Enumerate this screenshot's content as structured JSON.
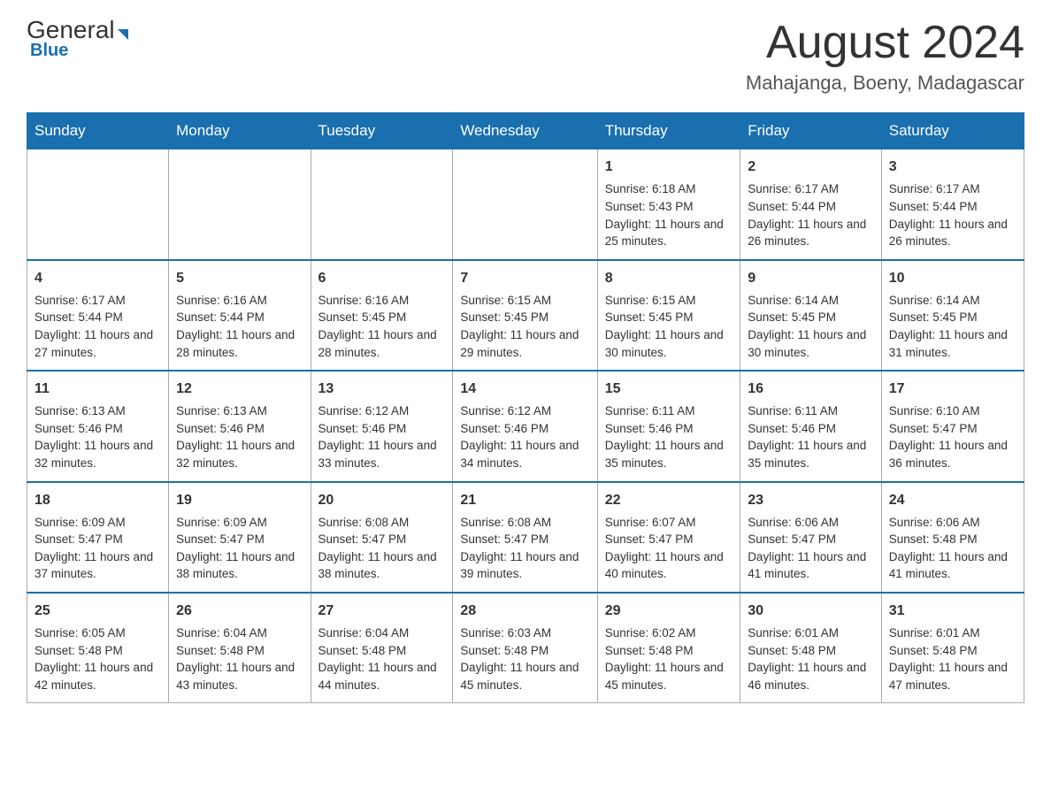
{
  "header": {
    "logo_general": "General",
    "logo_blue": "Blue",
    "month_title": "August 2024",
    "location": "Mahajanga, Boeny, Madagascar"
  },
  "calendar": {
    "days_of_week": [
      "Sunday",
      "Monday",
      "Tuesday",
      "Wednesday",
      "Thursday",
      "Friday",
      "Saturday"
    ],
    "weeks": [
      [
        {
          "day": "",
          "info": ""
        },
        {
          "day": "",
          "info": ""
        },
        {
          "day": "",
          "info": ""
        },
        {
          "day": "",
          "info": ""
        },
        {
          "day": "1",
          "info": "Sunrise: 6:18 AM\nSunset: 5:43 PM\nDaylight: 11 hours and 25 minutes."
        },
        {
          "day": "2",
          "info": "Sunrise: 6:17 AM\nSunset: 5:44 PM\nDaylight: 11 hours and 26 minutes."
        },
        {
          "day": "3",
          "info": "Sunrise: 6:17 AM\nSunset: 5:44 PM\nDaylight: 11 hours and 26 minutes."
        }
      ],
      [
        {
          "day": "4",
          "info": "Sunrise: 6:17 AM\nSunset: 5:44 PM\nDaylight: 11 hours and 27 minutes."
        },
        {
          "day": "5",
          "info": "Sunrise: 6:16 AM\nSunset: 5:44 PM\nDaylight: 11 hours and 28 minutes."
        },
        {
          "day": "6",
          "info": "Sunrise: 6:16 AM\nSunset: 5:45 PM\nDaylight: 11 hours and 28 minutes."
        },
        {
          "day": "7",
          "info": "Sunrise: 6:15 AM\nSunset: 5:45 PM\nDaylight: 11 hours and 29 minutes."
        },
        {
          "day": "8",
          "info": "Sunrise: 6:15 AM\nSunset: 5:45 PM\nDaylight: 11 hours and 30 minutes."
        },
        {
          "day": "9",
          "info": "Sunrise: 6:14 AM\nSunset: 5:45 PM\nDaylight: 11 hours and 30 minutes."
        },
        {
          "day": "10",
          "info": "Sunrise: 6:14 AM\nSunset: 5:45 PM\nDaylight: 11 hours and 31 minutes."
        }
      ],
      [
        {
          "day": "11",
          "info": "Sunrise: 6:13 AM\nSunset: 5:46 PM\nDaylight: 11 hours and 32 minutes."
        },
        {
          "day": "12",
          "info": "Sunrise: 6:13 AM\nSunset: 5:46 PM\nDaylight: 11 hours and 32 minutes."
        },
        {
          "day": "13",
          "info": "Sunrise: 6:12 AM\nSunset: 5:46 PM\nDaylight: 11 hours and 33 minutes."
        },
        {
          "day": "14",
          "info": "Sunrise: 6:12 AM\nSunset: 5:46 PM\nDaylight: 11 hours and 34 minutes."
        },
        {
          "day": "15",
          "info": "Sunrise: 6:11 AM\nSunset: 5:46 PM\nDaylight: 11 hours and 35 minutes."
        },
        {
          "day": "16",
          "info": "Sunrise: 6:11 AM\nSunset: 5:46 PM\nDaylight: 11 hours and 35 minutes."
        },
        {
          "day": "17",
          "info": "Sunrise: 6:10 AM\nSunset: 5:47 PM\nDaylight: 11 hours and 36 minutes."
        }
      ],
      [
        {
          "day": "18",
          "info": "Sunrise: 6:09 AM\nSunset: 5:47 PM\nDaylight: 11 hours and 37 minutes."
        },
        {
          "day": "19",
          "info": "Sunrise: 6:09 AM\nSunset: 5:47 PM\nDaylight: 11 hours and 38 minutes."
        },
        {
          "day": "20",
          "info": "Sunrise: 6:08 AM\nSunset: 5:47 PM\nDaylight: 11 hours and 38 minutes."
        },
        {
          "day": "21",
          "info": "Sunrise: 6:08 AM\nSunset: 5:47 PM\nDaylight: 11 hours and 39 minutes."
        },
        {
          "day": "22",
          "info": "Sunrise: 6:07 AM\nSunset: 5:47 PM\nDaylight: 11 hours and 40 minutes."
        },
        {
          "day": "23",
          "info": "Sunrise: 6:06 AM\nSunset: 5:47 PM\nDaylight: 11 hours and 41 minutes."
        },
        {
          "day": "24",
          "info": "Sunrise: 6:06 AM\nSunset: 5:48 PM\nDaylight: 11 hours and 41 minutes."
        }
      ],
      [
        {
          "day": "25",
          "info": "Sunrise: 6:05 AM\nSunset: 5:48 PM\nDaylight: 11 hours and 42 minutes."
        },
        {
          "day": "26",
          "info": "Sunrise: 6:04 AM\nSunset: 5:48 PM\nDaylight: 11 hours and 43 minutes."
        },
        {
          "day": "27",
          "info": "Sunrise: 6:04 AM\nSunset: 5:48 PM\nDaylight: 11 hours and 44 minutes."
        },
        {
          "day": "28",
          "info": "Sunrise: 6:03 AM\nSunset: 5:48 PM\nDaylight: 11 hours and 45 minutes."
        },
        {
          "day": "29",
          "info": "Sunrise: 6:02 AM\nSunset: 5:48 PM\nDaylight: 11 hours and 45 minutes."
        },
        {
          "day": "30",
          "info": "Sunrise: 6:01 AM\nSunset: 5:48 PM\nDaylight: 11 hours and 46 minutes."
        },
        {
          "day": "31",
          "info": "Sunrise: 6:01 AM\nSunset: 5:48 PM\nDaylight: 11 hours and 47 minutes."
        }
      ]
    ]
  }
}
